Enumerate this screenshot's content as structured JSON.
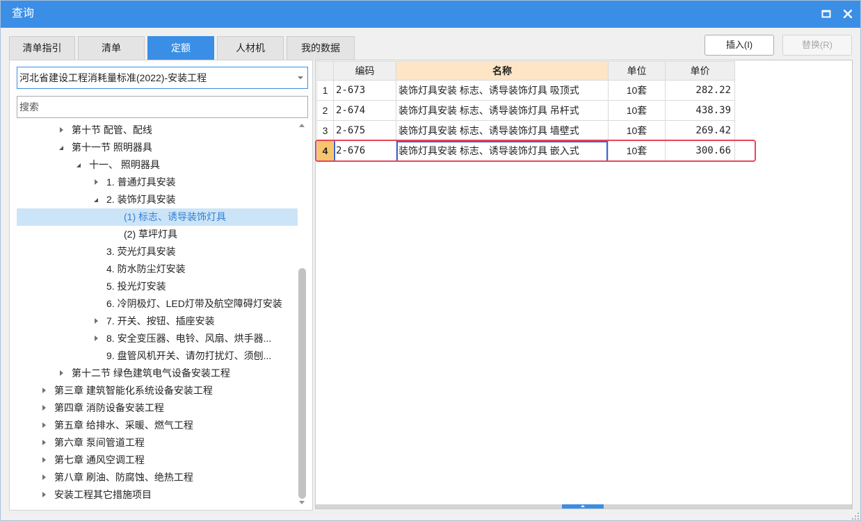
{
  "window": {
    "title": "查询",
    "maximize_icon": "maximize-icon",
    "close_icon": "close-icon",
    "resize_icon": "resize-grip-icon"
  },
  "tabs": [
    {
      "label": "清单指引",
      "active": false
    },
    {
      "label": "清单",
      "active": false
    },
    {
      "label": "定额",
      "active": true
    },
    {
      "label": "人材机",
      "active": false
    },
    {
      "label": "我的数据",
      "active": false
    }
  ],
  "actions": {
    "insert_label": "插入(I)",
    "replace_label": "替换(R)",
    "replace_enabled": false
  },
  "left": {
    "standard_select": {
      "value": "河北省建设工程消耗量标准(2022)-安装工程",
      "icon": "chevron-down-icon"
    },
    "search": {
      "value": "",
      "placeholder": "搜索",
      "icon": ""
    },
    "tree": [
      {
        "label": "第十节 配管、配线",
        "depth": 2,
        "icon": "caret-right-icon"
      },
      {
        "label": "第十一节 照明器具",
        "depth": 2,
        "icon": "caret-down-icon"
      },
      {
        "label": "十一、 照明器具",
        "depth": 3,
        "icon": "caret-down-icon"
      },
      {
        "label": "1. 普通灯具安装",
        "depth": 4,
        "icon": "caret-right-icon"
      },
      {
        "label": "2. 装饰灯具安装",
        "depth": 4,
        "icon": "caret-down-icon"
      },
      {
        "label": "(1) 标志、诱导装饰灯具",
        "depth": 5,
        "selected": true
      },
      {
        "label": "(2) 草坪灯具",
        "depth": 5
      },
      {
        "label": "3. 荧光灯具安装",
        "depth": 4
      },
      {
        "label": "4. 防水防尘灯安装",
        "depth": 4
      },
      {
        "label": "5. 投光灯安装",
        "depth": 4
      },
      {
        "label": "6. 冷阴极灯、LED灯带及航空障碍灯安装",
        "depth": 4
      },
      {
        "label": "7. 开关、按钮、插座安装",
        "depth": 4,
        "icon": "caret-right-icon"
      },
      {
        "label": "8. 安全变压器、电铃、风扇、烘手器...",
        "depth": 4,
        "icon": "caret-right-icon"
      },
      {
        "label": "9. 盘管风机开关、请勿打扰灯、须刨...",
        "depth": 4
      },
      {
        "label": "第十二节 绿色建筑电气设备安装工程",
        "depth": 2,
        "icon": "caret-right-icon"
      },
      {
        "label": "第三章 建筑智能化系统设备安装工程",
        "depth": 1,
        "icon": "caret-right-icon"
      },
      {
        "label": "第四章 消防设备安装工程",
        "depth": 1,
        "icon": "caret-right-icon"
      },
      {
        "label": "第五章 给排水、采暖、燃气工程",
        "depth": 1,
        "icon": "caret-right-icon"
      },
      {
        "label": "第六章 泵间管道工程",
        "depth": 1,
        "icon": "caret-right-icon"
      },
      {
        "label": "第七章 通风空调工程",
        "depth": 1,
        "icon": "caret-right-icon"
      },
      {
        "label": "第八章 刷油、防腐蚀、绝热工程",
        "depth": 1,
        "icon": "caret-right-icon"
      },
      {
        "label": "安装工程其它措施项目",
        "depth": 1,
        "icon": "caret-right-icon"
      }
    ]
  },
  "table": {
    "columns": {
      "code": "编码",
      "name": "名称",
      "unit": "单位",
      "price": "单价"
    },
    "rows": [
      {
        "no": "1",
        "code": "2-673",
        "name": "装饰灯具安装 标志、诱导装饰灯具 吸顶式",
        "unit": "10套",
        "price": "282.22"
      },
      {
        "no": "2",
        "code": "2-674",
        "name": "装饰灯具安装 标志、诱导装饰灯具 吊杆式",
        "unit": "10套",
        "price": "438.39"
      },
      {
        "no": "3",
        "code": "2-675",
        "name": "装饰灯具安装 标志、诱导装饰灯具 墙壁式",
        "unit": "10套",
        "price": "269.42"
      },
      {
        "no": "4",
        "code": "2-676",
        "name": "装饰灯具安装 标志、诱导装饰灯具 嵌入式",
        "unit": "10套",
        "price": "300.66",
        "current": true
      }
    ],
    "splitter_icon": "chevron-up-icon"
  },
  "colors": {
    "accent": "#3a8ee6",
    "selected_bg": "#cce4f7",
    "selected_text": "#2f80d6",
    "annotation": "#e8445a",
    "current_row_marker": "#f7c56b",
    "name_header_bg": "#fde5c6",
    "focus": "#3d63d2"
  }
}
